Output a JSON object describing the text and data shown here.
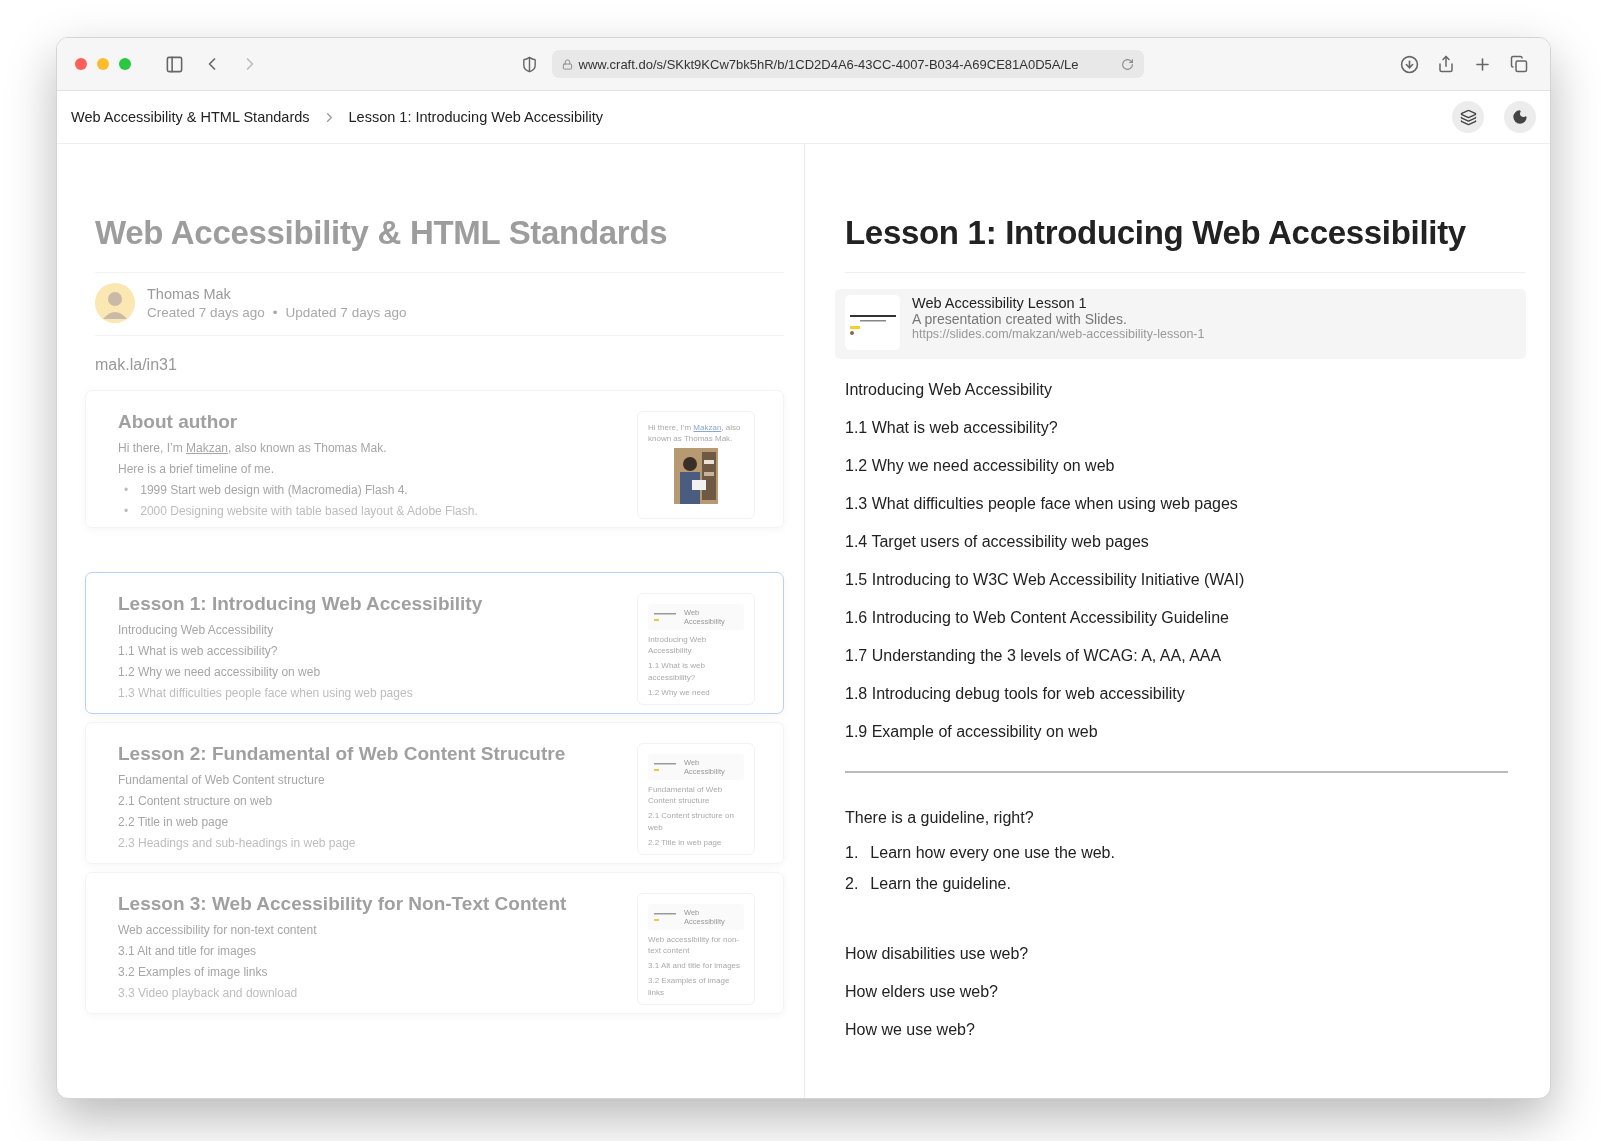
{
  "browser": {
    "url": "www.craft.do/s/SKkt9KCw7bk5hR/b/1CD2D4A6-43CC-4007-B034-A69CE81A0D5A/Le"
  },
  "breadcrumbs": [
    {
      "label": "Web Accessibility & HTML Standards"
    },
    {
      "label": "Lesson 1: Introducing Web Accessibility"
    }
  ],
  "document": {
    "title": "Web Accessibility & HTML Standards",
    "author": {
      "name": "Thomas Mak",
      "created": "Created 7 days ago",
      "separator": "•",
      "updated": "Updated 7 days ago"
    },
    "link": "mak.la/in31",
    "cards": [
      {
        "kind": "about",
        "selected": false,
        "title": "About author",
        "intro": "Hi there, I’m ",
        "intro_link": "Makzan",
        "intro_rest": ", also known as Thomas Mak.",
        "lines": [
          "Here is a brief timeline of me."
        ],
        "bullet_marker": "•",
        "bullets": [
          "1999 Start web design with (Macromedia) Flash 4.",
          "2000 Designing website with table based layout & Adobe Flash."
        ],
        "preview": {
          "intro": "Hi there, I’m ",
          "intro_link": "Makzan",
          "intro_rest": ", also known as Thomas Mak."
        }
      },
      {
        "kind": "lesson",
        "selected": true,
        "title": "Lesson 1: Introducing Web Accessibility",
        "lines": [
          "Introducing Web Accessibility",
          "1.1 What is web accessibility?",
          "1.2 Why we need accessibility on web",
          "1.3 What difficulties people face when using web pages"
        ],
        "preview": {
          "heading": "Web Accessibility",
          "lines": [
            "Introducing Web Accessibility",
            "1.1 What is web accessibility?",
            "1.2 Why we need"
          ]
        }
      },
      {
        "kind": "lesson",
        "selected": false,
        "title": "Lesson 2: Fundamental of Web Content Strucutre",
        "lines": [
          "Fundamental of Web Content structure",
          "2.1 Content structure on web",
          "2.2 Title in web page",
          "2.3 Headings and sub-headings in web page"
        ],
        "preview": {
          "heading": "Web Accessibility",
          "lines": [
            "Fundamental of Web Content structure",
            "2.1 Content structure on web",
            "2.2 Title in web page"
          ]
        }
      },
      {
        "kind": "lesson",
        "selected": false,
        "title": "Lesson 3: Web Accessibility for Non-Text Content",
        "lines": [
          "Web accessibility for non-text content",
          "3.1 Alt and title for images",
          "3.2 Examples of image links",
          "3.3 Video playback and download"
        ],
        "preview": {
          "heading": "Web Accessibility",
          "lines": [
            "Web accessibility for non-text content",
            "3.1 Alt and title for images",
            "3.2 Examples of image links"
          ]
        }
      }
    ]
  },
  "page": {
    "title": "Lesson 1: Introducing Web Accessibility",
    "embed": {
      "title": "Web Accessibility Lesson 1",
      "description": "A presentation created with Slides.",
      "url": "https://slides.com/makzan/web-accessibility-lesson-1"
    },
    "toc": [
      "Introducing Web Accessibility",
      "1.1 What is web accessibility?",
      "1.2 Why we need accessibility on web",
      "1.3 What difficulties people face when using web pages",
      "1.4 Target users of accessibility web pages",
      "1.5 Introducing to W3C Web Accessibility Initiative (WAI)",
      "1.6 Introducing to Web Content Accessibility Guideline",
      "1.7 Understanding the 3 levels of WCAG: A, AA, AAA",
      "1.8 Introducing debug tools for web accessibility",
      "1.9 Example of accessibility on web"
    ],
    "guideline": "There is a guideline, right?",
    "steps": [
      {
        "number": "1.",
        "text": "Learn how every one use the web."
      },
      {
        "number": "2.",
        "text": "Learn the guideline."
      }
    ],
    "questions": [
      "How disabilities use web?",
      "How elders use web?",
      "How we use web?"
    ]
  }
}
